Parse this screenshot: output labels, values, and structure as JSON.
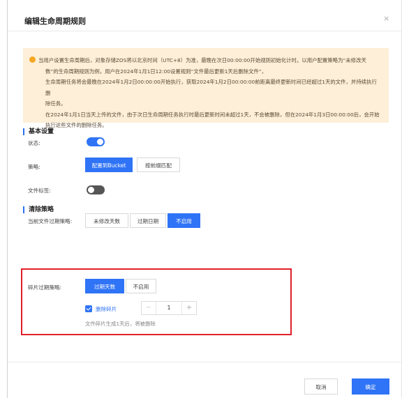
{
  "dialog": {
    "title": "编辑生命周期规则",
    "close_glyph": "×"
  },
  "notice": {
    "icon": "warning-dot-icon",
    "lines": [
      "当用户设置生命周期后，对象存储ZOS将以北京时间（UTC+8）为准，最晚在次日00:00:00开始规则初始化计时。以用户配置策略为“未修改天",
      "数”的生命周期规则为例，用户在2024年1月1日12:00设置规则“文件最后更新1天后删除文件”，",
      "生命周期任务将会最晚在2024年1月2日00:00:00开始执行，获取2024年1月2日00:00:00前距离最终更新时间已经超过1天的文件，并持续执行删",
      "除任务。",
      "在2024年1月1日当天上传的文件，由于次日生命周期任务执行时最后更新时间未超过1天，不会被删除，但在2024年1月3日00:00:00后，会开始",
      "执行这些文件的删除任务。"
    ]
  },
  "basic": {
    "section_title": "基本设置",
    "status_label": "状态:",
    "status_on": true,
    "strategy_label": "策略:",
    "strategy_options": [
      "配置到Bucket",
      "按前缀匹配"
    ],
    "tag_label": "文件标签:",
    "tag_on": false
  },
  "clear": {
    "section_title": "清除策略",
    "current_label": "当前文件过期策略:",
    "current_options": [
      "未修改天数",
      "过期日期",
      "不启用"
    ],
    "fragment_label": "碎片过期策略:",
    "fragment_options": [
      "过期天数",
      "不启用"
    ],
    "delete_fragment_label": "删除碎片",
    "delete_fragment_checked": true,
    "stepper_minus": "−",
    "stepper_value": "1",
    "stepper_plus": "+",
    "hint": "文件碎片生成1天后，将被删除"
  },
  "footer": {
    "cancel": "取消",
    "confirm": "确定"
  },
  "colors": {
    "primary": "#2f73f6",
    "highlight_box": "#e0202a",
    "notice_bg": "#fdefd8"
  }
}
